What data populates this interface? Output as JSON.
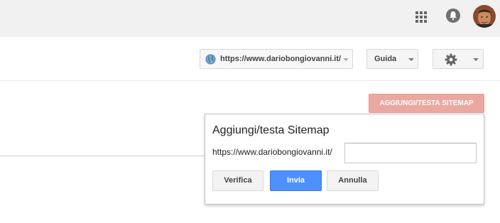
{
  "header": {
    "apps_icon": "apps-grid-icon",
    "notifications_icon": "bell-icon",
    "avatar": "user-avatar"
  },
  "toolbar": {
    "property_label": "https://www.dariobongiovanni.it/",
    "help_label": "Guida",
    "settings_icon": "gear-icon"
  },
  "main": {
    "add_sitemap_label": "AGGIUNGI/TESTA SITEMAP"
  },
  "dialog": {
    "title": "Aggiungi/testa Sitemap",
    "url_prefix": "https://www.dariobongiovanni.it/",
    "input_value": "",
    "verify_label": "Verifica",
    "submit_label": "Invia",
    "cancel_label": "Annulla"
  },
  "colors": {
    "accent_red_disabled": "#eba8a1",
    "primary_blue": "#4d90fe",
    "topbar_bg": "#f1f1f1"
  }
}
